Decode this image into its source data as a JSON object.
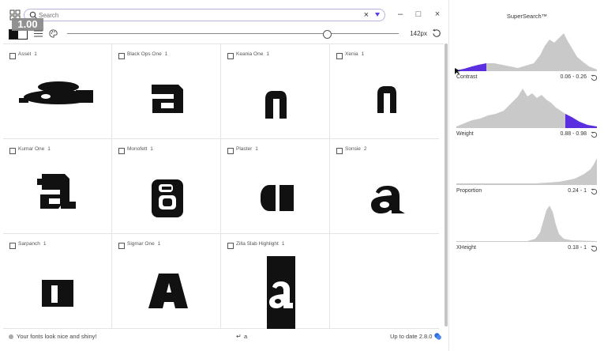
{
  "search": {
    "placeholder": "Search",
    "clear_glyph": "×"
  },
  "window": {
    "minimize": "–",
    "maximize": "□",
    "close": "×"
  },
  "zoom_badge": "1.00",
  "toolbar": {
    "size_label": "142px",
    "size_value": 142
  },
  "fonts": [
    {
      "name": "Asset",
      "count": "1",
      "glyph": "a"
    },
    {
      "name": "Black Ops One",
      "count": "1",
      "glyph": "a"
    },
    {
      "name": "Keania One",
      "count": "1",
      "glyph": "a"
    },
    {
      "name": "Xenia",
      "count": "1",
      "glyph": "a"
    },
    {
      "name": "Kumar One",
      "count": "1",
      "glyph": "a"
    },
    {
      "name": "Monofett",
      "count": "1",
      "glyph": "a"
    },
    {
      "name": "Plaster",
      "count": "1",
      "glyph": "a"
    },
    {
      "name": "Sonsie",
      "count": "2",
      "glyph": "a"
    },
    {
      "name": "Sarpanch",
      "count": "1",
      "glyph": "a"
    },
    {
      "name": "Sigmar One",
      "count": "1",
      "glyph": "A"
    },
    {
      "name": "Zilla Slab Highlight",
      "count": "1",
      "glyph": "a"
    }
  ],
  "status": {
    "message": "Your fonts look nice and shiny!",
    "enter_glyph": "↵",
    "preview": "a",
    "version": "Up to date 2.8.0"
  },
  "panel": {
    "title": "SuperSearch™",
    "filters": [
      {
        "name": "Contrast",
        "range": "0.06 - 0.26"
      },
      {
        "name": "Weight",
        "range": "0.88 - 0.98"
      },
      {
        "name": "Proportion",
        "range": "0.24 - 1"
      },
      {
        "name": "XHeight",
        "range": "0.18 - 1"
      }
    ]
  },
  "colors": {
    "accent": "#5b2fe0",
    "histogram": "#c9c9c9",
    "search_border": "#b9b3df"
  },
  "icons": [
    "grid-view-icon",
    "search-icon",
    "dropdown-icon",
    "list-icon",
    "palette-icon",
    "reset-icon",
    "chat-icon"
  ]
}
